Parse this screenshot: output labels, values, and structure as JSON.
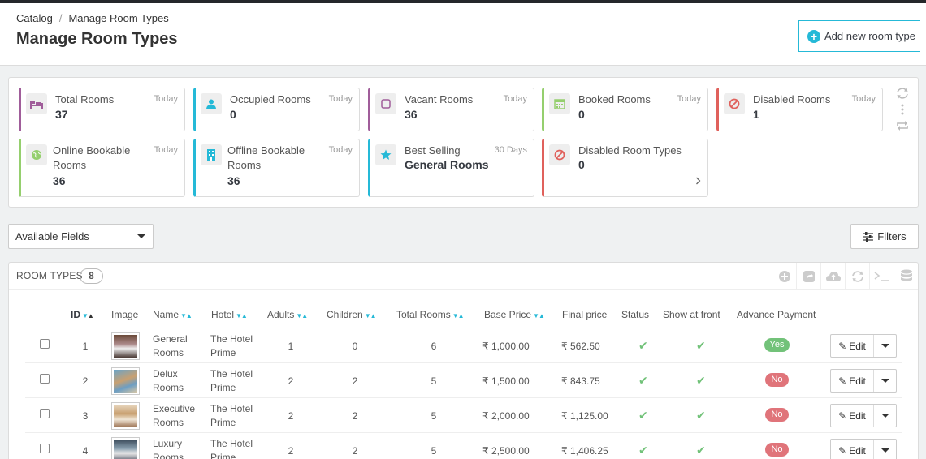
{
  "breadcrumb": {
    "parent": "Catalog",
    "sep": "/",
    "current": "Manage Room Types"
  },
  "page_title": "Manage Room Types",
  "add_button": "Add new room type",
  "kpis": [
    {
      "title": "Total Rooms",
      "period": "Today",
      "value": "37",
      "color": "#a05d9a",
      "icon": "bed-icon"
    },
    {
      "title": "Occupied Rooms",
      "period": "Today",
      "value": "0",
      "color": "#25b9d7",
      "icon": "user-icon"
    },
    {
      "title": "Vacant Rooms",
      "period": "Today",
      "value": "36",
      "color": "#a05d9a",
      "icon": "square-icon"
    },
    {
      "title": "Booked Rooms",
      "period": "Today",
      "value": "0",
      "color": "#95cf6e",
      "icon": "calendar-icon"
    },
    {
      "title": "Disabled Rooms",
      "period": "Today",
      "value": "1",
      "color": "#e0615c",
      "icon": "ban-icon"
    },
    {
      "title1": "Online Bookable",
      "title2": "Rooms",
      "period": "Today",
      "value": "36",
      "color": "#95cf6e",
      "icon": "globe-icon"
    },
    {
      "title1": "Offline Bookable",
      "title2": "Rooms",
      "period": "Today",
      "value": "36",
      "color": "#25b9d7",
      "icon": "building-icon"
    },
    {
      "title": "Best Selling",
      "period": "30 Days",
      "value": "General Rooms",
      "color": "#25b9d7",
      "icon": "star-icon"
    },
    {
      "title": "Disabled Room Types",
      "period": "",
      "value": "0",
      "color": "#e0615c",
      "icon": "ban-icon"
    }
  ],
  "available_fields": "Available Fields",
  "filters_button": "Filters",
  "table": {
    "title": "ROOM TYPES",
    "count": "8",
    "columns": [
      "ID",
      "Image",
      "Name",
      "Hotel",
      "Adults",
      "Children",
      "Total Rooms",
      "Base Price",
      "Final price",
      "Status",
      "Show at front",
      "Advance Payment"
    ],
    "edit_label": "Edit",
    "rows": [
      {
        "id": "1",
        "name1": "General",
        "name2": "Rooms",
        "hotel1": "The Hotel",
        "hotel2": "Prime",
        "adults": "1",
        "children": "0",
        "total": "6",
        "base": "₹ 1,000.00",
        "final": "₹ 562.50",
        "advance": "Yes"
      },
      {
        "id": "2",
        "name1": "Delux",
        "name2": "Rooms",
        "hotel1": "The Hotel",
        "hotel2": "Prime",
        "adults": "2",
        "children": "2",
        "total": "5",
        "base": "₹ 1,500.00",
        "final": "₹ 843.75",
        "advance": "No"
      },
      {
        "id": "3",
        "name1": "Executive",
        "name2": "Rooms",
        "hotel1": "The Hotel",
        "hotel2": "Prime",
        "adults": "2",
        "children": "2",
        "total": "5",
        "base": "₹ 2,000.00",
        "final": "₹ 1,125.00",
        "advance": "No"
      },
      {
        "id": "4",
        "name1": "Luxury",
        "name2": "Rooms",
        "hotel1": "The Hotel",
        "hotel2": "Prime",
        "adults": "2",
        "children": "2",
        "total": "5",
        "base": "₹ 2,500.00",
        "final": "₹ 1,406.25",
        "advance": "No"
      }
    ]
  },
  "colors": {
    "accent": "#25b9d7",
    "yes": "#72c279",
    "no": "#e0747a",
    "check": "#72c279"
  }
}
